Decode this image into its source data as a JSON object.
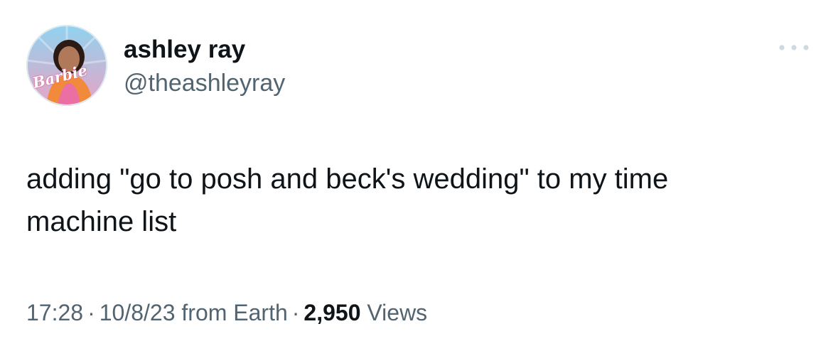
{
  "author": {
    "display_name": "ashley ray",
    "handle": "@theashleyray",
    "avatar_badge_text": "Barbie"
  },
  "tweet": {
    "text_lines": [
      "adding \"go to posh and beck's wedding\" to my time",
      "machine list"
    ]
  },
  "meta": {
    "time": "17:28",
    "date": "10/8/23",
    "source": "from Earth",
    "separator": "·",
    "views_count": "2,950",
    "views_label": "Views"
  },
  "icons": {
    "more": "more-horizontal-icon"
  },
  "colors": {
    "text_primary": "#0f1419",
    "text_secondary": "#536471",
    "avatar_ring": "#dbe9f0",
    "barbie_pink": "#e7487e"
  }
}
